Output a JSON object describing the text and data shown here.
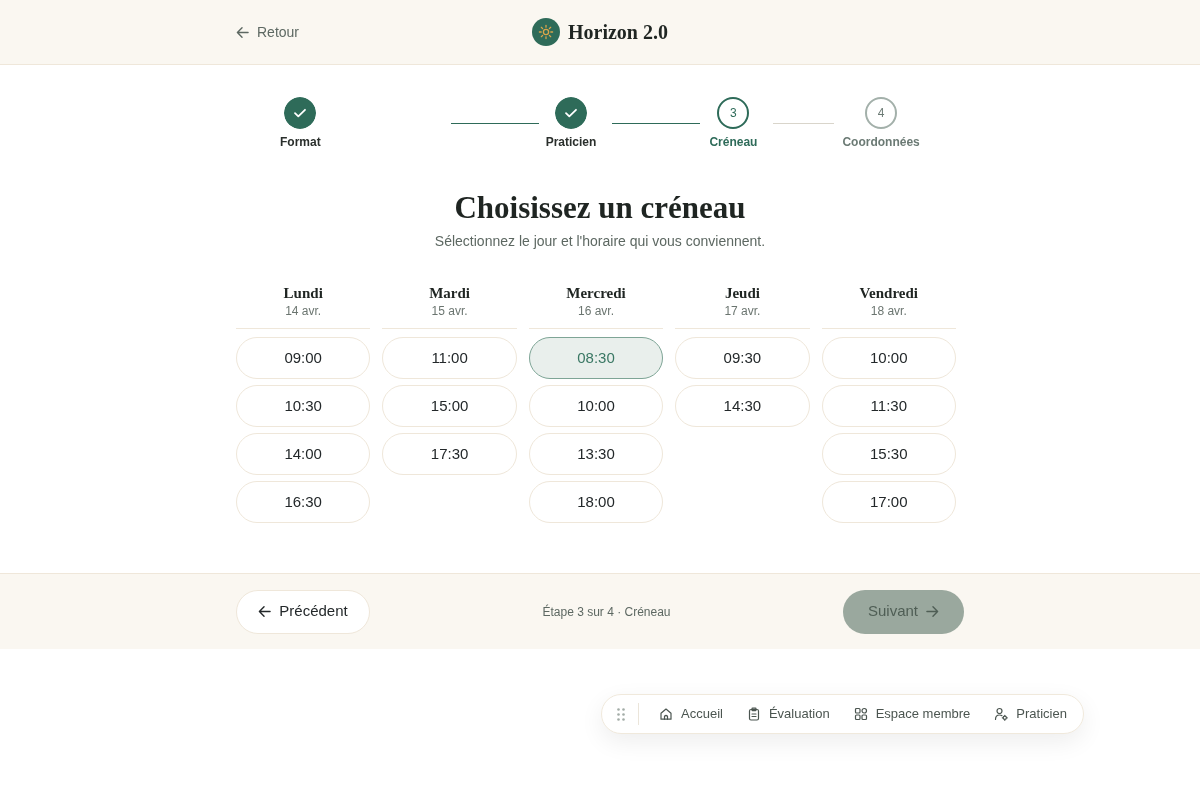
{
  "header": {
    "back_link": "Retour",
    "brand": "Horizon 2.0"
  },
  "stepper": [
    {
      "label": "Format",
      "completed": true,
      "selected": false
    },
    {
      "label": "Praticien",
      "completed": true,
      "selected": false
    },
    {
      "label": "Créneau",
      "number": "3",
      "completed": false,
      "selected": true
    },
    {
      "label": "Coordonnées",
      "number": "4",
      "completed": false,
      "selected": false
    }
  ],
  "heading": {
    "title": "Choisissez un créneau",
    "subtitle": "Sélectionnez le jour et l'horaire qui vous conviennent."
  },
  "days": [
    {
      "name": "Lundi",
      "date": "14 avr.",
      "slots": [
        {
          "time": "09:00",
          "selected": false
        },
        {
          "time": "10:30",
          "selected": false
        },
        {
          "time": "14:00",
          "selected": false
        },
        {
          "time": "16:30",
          "selected": false
        }
      ]
    },
    {
      "name": "Mardi",
      "date": "15 avr.",
      "slots": [
        {
          "time": "11:00",
          "selected": false
        },
        {
          "time": "15:00",
          "selected": false
        },
        {
          "time": "17:30",
          "selected": false
        }
      ]
    },
    {
      "name": "Mercredi",
      "date": "16 avr.",
      "slots": [
        {
          "time": "08:30",
          "selected": true
        },
        {
          "time": "10:00",
          "selected": false
        },
        {
          "time": "13:30",
          "selected": false
        },
        {
          "time": "18:00",
          "selected": false
        }
      ]
    },
    {
      "name": "Jeudi",
      "date": "17 avr.",
      "slots": [
        {
          "time": "09:30",
          "selected": false
        },
        {
          "time": "14:30",
          "selected": false
        }
      ]
    },
    {
      "name": "Vendredi",
      "date": "18 avr.",
      "slots": [
        {
          "time": "10:00",
          "selected": false
        },
        {
          "time": "11:30",
          "selected": false
        },
        {
          "time": "15:30",
          "selected": false
        },
        {
          "time": "17:00",
          "selected": false
        }
      ]
    }
  ],
  "footer": {
    "previous_button": "Précédent",
    "progress": "Étape 3 sur 4 · Créneau",
    "next_button": {
      "label": "Suivant",
      "disabled": true
    }
  },
  "dock": {
    "items": [
      {
        "label": "Accueil"
      },
      {
        "label": "Évaluation"
      },
      {
        "label": "Espace membre"
      },
      {
        "label": "Praticien"
      }
    ]
  }
}
